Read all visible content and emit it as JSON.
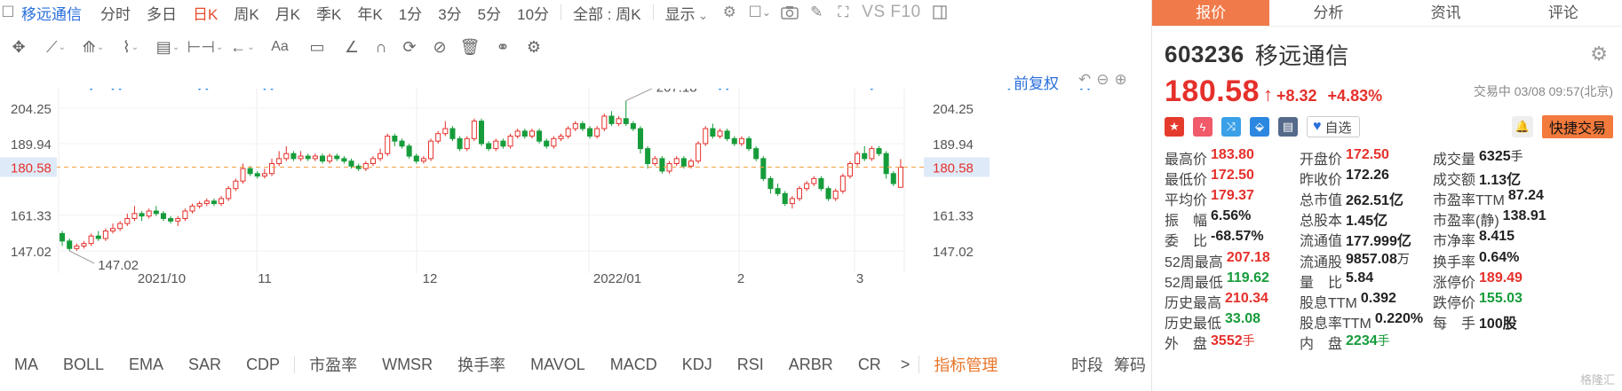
{
  "toolbar": {
    "stock_name": "移远通信",
    "timeframes": [
      {
        "label": "分时",
        "active": false
      },
      {
        "label": "多日",
        "active": false
      },
      {
        "label": "日K",
        "active": true
      },
      {
        "label": "周K",
        "active": false
      },
      {
        "label": "月K",
        "active": false
      },
      {
        "label": "季K",
        "active": false
      },
      {
        "label": "年K",
        "active": false
      },
      {
        "label": "1分",
        "active": false
      },
      {
        "label": "3分",
        "active": false
      },
      {
        "label": "5分",
        "active": false
      },
      {
        "label": "10分",
        "active": false
      }
    ],
    "all_select": "全部 : 周K",
    "display_label": "显示",
    "vs_label": "VS F10"
  },
  "drawing_tools": [
    "move-icon",
    "line-icon",
    "channel-icon",
    "wave-icon",
    "fib-icon",
    "measure-icon",
    "arrow-icon",
    "text-icon",
    "comment-icon",
    "ruler-icon",
    "magnet-icon",
    "refresh-icon",
    "hide-icon",
    "delete-icon",
    "link-icon",
    "settings-icon"
  ],
  "chart_controls": {
    "fuquan": "前复权"
  },
  "chart_data": {
    "type": "candlestick",
    "title": "",
    "y_ticks": [
      204.25,
      189.94,
      161.33,
      147.02
    ],
    "x_labels": [
      "2021/10",
      "11",
      "12",
      "2022/01",
      "2",
      "3"
    ],
    "ylim": [
      141,
      212
    ],
    "high_label": "207.18",
    "low_label": "147.02",
    "current_price_label": "180.58",
    "current_price": 180.58,
    "colors": {
      "up": "#e5302b",
      "down": "#169c3a",
      "price_line": "#f5a047",
      "marker": "#2a8cf0"
    },
    "candles": [
      [
        154,
        151,
        155,
        149
      ],
      [
        151,
        148,
        152,
        147
      ],
      [
        148,
        149,
        150,
        147.02
      ],
      [
        149,
        150,
        151,
        148
      ],
      [
        150,
        153,
        154,
        149
      ],
      [
        153,
        152,
        155,
        151
      ],
      [
        152,
        155,
        156,
        151
      ],
      [
        155,
        156,
        158,
        154
      ],
      [
        156,
        158,
        159,
        155
      ],
      [
        158,
        160,
        162,
        157
      ],
      [
        160,
        162,
        165,
        159
      ],
      [
        162,
        161,
        163,
        159
      ],
      [
        161,
        163,
        164,
        160
      ],
      [
        163,
        162,
        165,
        161
      ],
      [
        162,
        160,
        163,
        159
      ],
      [
        160,
        159,
        161,
        158
      ],
      [
        159,
        160,
        161,
        157
      ],
      [
        160,
        163,
        164,
        159
      ],
      [
        163,
        165,
        166,
        162
      ],
      [
        165,
        166,
        167,
        164
      ],
      [
        166,
        167,
        168,
        165
      ],
      [
        167,
        166,
        168,
        165
      ],
      [
        166,
        168,
        169,
        165
      ],
      [
        168,
        172,
        173,
        167
      ],
      [
        172,
        175,
        176,
        171
      ],
      [
        175,
        180,
        182,
        174
      ],
      [
        180,
        178,
        181,
        177
      ],
      [
        178,
        177,
        179,
        176
      ],
      [
        177,
        178,
        180,
        176
      ],
      [
        178,
        182,
        184,
        177
      ],
      [
        182,
        184,
        187,
        181
      ],
      [
        184,
        186,
        189,
        183
      ],
      [
        186,
        184,
        187,
        183
      ],
      [
        184,
        185,
        187,
        183
      ],
      [
        185,
        184,
        186,
        183
      ],
      [
        184,
        185,
        186,
        183
      ],
      [
        185,
        183,
        186,
        182
      ],
      [
        183,
        185,
        186,
        182
      ],
      [
        185,
        184,
        186,
        183
      ],
      [
        184,
        183,
        185,
        182
      ],
      [
        183,
        181,
        184,
        180
      ],
      [
        181,
        180,
        182,
        179
      ],
      [
        180,
        182,
        183,
        179
      ],
      [
        182,
        184,
        185,
        181
      ],
      [
        184,
        186,
        188,
        183
      ],
      [
        186,
        193,
        194,
        185
      ],
      [
        193,
        191,
        194,
        189
      ],
      [
        191,
        189,
        192,
        188
      ],
      [
        189,
        185,
        190,
        184
      ],
      [
        185,
        183,
        186,
        182
      ],
      [
        183,
        184,
        185,
        182
      ],
      [
        184,
        191,
        192,
        183
      ],
      [
        191,
        194,
        195,
        190
      ],
      [
        194,
        196,
        199,
        193
      ],
      [
        196,
        192,
        197,
        191
      ],
      [
        192,
        188,
        193,
        187
      ],
      [
        188,
        192,
        193,
        187
      ],
      [
        192,
        199,
        200,
        191
      ],
      [
        199,
        190,
        200,
        189
      ],
      [
        190,
        188,
        191,
        187
      ],
      [
        188,
        191,
        192,
        187
      ],
      [
        191,
        189,
        192,
        188
      ],
      [
        189,
        193,
        194,
        188
      ],
      [
        193,
        195,
        196,
        192
      ],
      [
        195,
        193,
        196,
        192
      ],
      [
        193,
        195,
        196,
        192
      ],
      [
        195,
        191,
        196,
        190
      ],
      [
        191,
        189,
        192,
        188
      ],
      [
        189,
        192,
        193,
        188
      ],
      [
        192,
        193,
        194,
        191
      ],
      [
        193,
        196,
        197,
        192
      ],
      [
        196,
        198,
        199,
        195
      ],
      [
        198,
        196,
        199,
        195
      ],
      [
        196,
        193,
        197,
        192
      ],
      [
        193,
        196,
        197,
        192
      ],
      [
        196,
        201,
        202,
        195
      ],
      [
        201,
        198,
        203,
        197
      ],
      [
        198,
        200,
        201,
        197
      ],
      [
        200,
        198,
        207.18,
        197
      ],
      [
        198,
        196,
        199,
        195
      ],
      [
        196,
        188,
        197,
        186
      ],
      [
        188,
        182,
        189,
        180
      ],
      [
        182,
        184,
        185,
        181
      ],
      [
        184,
        179,
        185,
        178
      ],
      [
        179,
        182,
        183,
        178
      ],
      [
        182,
        184,
        185,
        181
      ],
      [
        184,
        181,
        185,
        180
      ],
      [
        181,
        183,
        184,
        180
      ],
      [
        183,
        190,
        191,
        182
      ],
      [
        190,
        196,
        197,
        189
      ],
      [
        196,
        193,
        198,
        192
      ],
      [
        193,
        195,
        196,
        192
      ],
      [
        195,
        192,
        196,
        191
      ],
      [
        192,
        190,
        193,
        189
      ],
      [
        190,
        192,
        193,
        189
      ],
      [
        192,
        188,
        193,
        187
      ],
      [
        188,
        184,
        189,
        183
      ],
      [
        184,
        176,
        185,
        175
      ],
      [
        176,
        172,
        177,
        170
      ],
      [
        172,
        170,
        174,
        169
      ],
      [
        170,
        166,
        171,
        165
      ],
      [
        166,
        168,
        169,
        164
      ],
      [
        168,
        172,
        173,
        167
      ],
      [
        172,
        174,
        175,
        171
      ],
      [
        174,
        176,
        177,
        173
      ],
      [
        176,
        172,
        177,
        171
      ],
      [
        172,
        168,
        173,
        167
      ],
      [
        168,
        171,
        172,
        167
      ],
      [
        171,
        177,
        178,
        170
      ],
      [
        177,
        182,
        183,
        176
      ],
      [
        182,
        186,
        187,
        181
      ],
      [
        186,
        184,
        189,
        183
      ],
      [
        184,
        188,
        189,
        183
      ],
      [
        188,
        186,
        189,
        185
      ],
      [
        186,
        178,
        187,
        176
      ],
      [
        178,
        174,
        179,
        173
      ],
      [
        172.5,
        180.58,
        183.8,
        172.5
      ]
    ],
    "marker_candles": [
      4,
      7,
      8,
      19,
      20,
      28,
      29,
      91,
      92,
      112,
      131,
      132,
      136,
      141,
      142
    ]
  },
  "indicators": [
    "MA",
    "BOLL",
    "EMA",
    "SAR",
    "CDP",
    "市盈率",
    "WMSR",
    "换手率",
    "MAVOL",
    "MACD",
    "KDJ",
    "RSI",
    "ARBR",
    "CR"
  ],
  "indicator_more": ">",
  "indicator_manage": "指标管理",
  "bottom_right": [
    "时段",
    "筹码"
  ],
  "tabs": [
    {
      "label": "报价",
      "active": true
    },
    {
      "label": "分析",
      "active": false
    },
    {
      "label": "资讯",
      "active": false
    },
    {
      "label": "评论",
      "active": false
    }
  ],
  "quote": {
    "code": "603236",
    "name": "移远通信",
    "price": "180.58",
    "arrow": "↑",
    "change": "+8.32",
    "change_pct": "+4.83%",
    "trade_info": "交易中 03/08 09:57(北京)",
    "watch_label": "自选",
    "quick_trade": "快捷交易"
  },
  "stats": [
    [
      {
        "label": "最高价",
        "value": "183.80",
        "unit": "",
        "color": "red"
      },
      {
        "label": "开盘价",
        "value": "172.50",
        "unit": "",
        "color": "red"
      },
      {
        "label": "成交量",
        "value": "6325",
        "unit": "手",
        "color": "dark"
      }
    ],
    [
      {
        "label": "最低价",
        "value": "172.50",
        "unit": "",
        "color": "red"
      },
      {
        "label": "昨收价",
        "value": "172.26",
        "unit": "",
        "color": "dark"
      },
      {
        "label": "成交额",
        "value": "1.13亿",
        "unit": "",
        "color": "dark"
      }
    ],
    [
      {
        "label": "平均价",
        "value": "179.37",
        "unit": "",
        "color": "red"
      },
      {
        "label": "总市值",
        "value": "262.51亿",
        "unit": "",
        "color": "dark"
      },
      {
        "label": "市盈率TTM",
        "value": "87.24",
        "unit": "",
        "color": "dark"
      }
    ],
    [
      {
        "label": "振　幅",
        "value": "6.56%",
        "unit": "",
        "color": "dark"
      },
      {
        "label": "总股本",
        "value": "1.45亿",
        "unit": "",
        "color": "dark"
      },
      {
        "label": "市盈率(静)",
        "value": "138.91",
        "unit": "",
        "color": "dark"
      }
    ],
    [
      {
        "label": "委　比",
        "value": "-68.57%",
        "unit": "",
        "color": "dark"
      },
      {
        "label": "流通值",
        "value": "177.999亿",
        "unit": "",
        "color": "dark"
      },
      {
        "label": "市净率",
        "value": "8.415",
        "unit": "",
        "color": "dark"
      }
    ],
    [
      {
        "label": "52周最高",
        "value": "207.18",
        "unit": "",
        "color": "red"
      },
      {
        "label": "流通股",
        "value": "9857.08",
        "unit": "万",
        "color": "dark"
      },
      {
        "label": "换手率",
        "value": "0.64%",
        "unit": "",
        "color": "dark"
      }
    ],
    [
      {
        "label": "52周最低",
        "value": "119.62",
        "unit": "",
        "color": "green"
      },
      {
        "label": "量　比",
        "value": "5.84",
        "unit": "",
        "color": "dark"
      },
      {
        "label": "涨停价",
        "value": "189.49",
        "unit": "",
        "color": "red"
      }
    ],
    [
      {
        "label": "历史最高",
        "value": "210.34",
        "unit": "",
        "color": "red"
      },
      {
        "label": "股息TTM",
        "value": "0.392",
        "unit": "",
        "color": "dark"
      },
      {
        "label": "跌停价",
        "value": "155.03",
        "unit": "",
        "color": "green"
      }
    ],
    [
      {
        "label": "历史最低",
        "value": "33.08",
        "unit": "",
        "color": "green"
      },
      {
        "label": "股息率TTM",
        "value": "0.220%",
        "unit": "",
        "color": "dark"
      },
      {
        "label": "每　手",
        "value": "100股",
        "unit": "",
        "color": "dark"
      }
    ],
    [
      {
        "label": "外　盘",
        "value": "3552",
        "unit": "手",
        "color": "red"
      },
      {
        "label": "内　盘",
        "value": "2234",
        "unit": "手",
        "color": "green"
      },
      {
        "label": "",
        "value": "",
        "unit": "",
        "color": "dark"
      }
    ]
  ],
  "watermark": "格隆汇"
}
